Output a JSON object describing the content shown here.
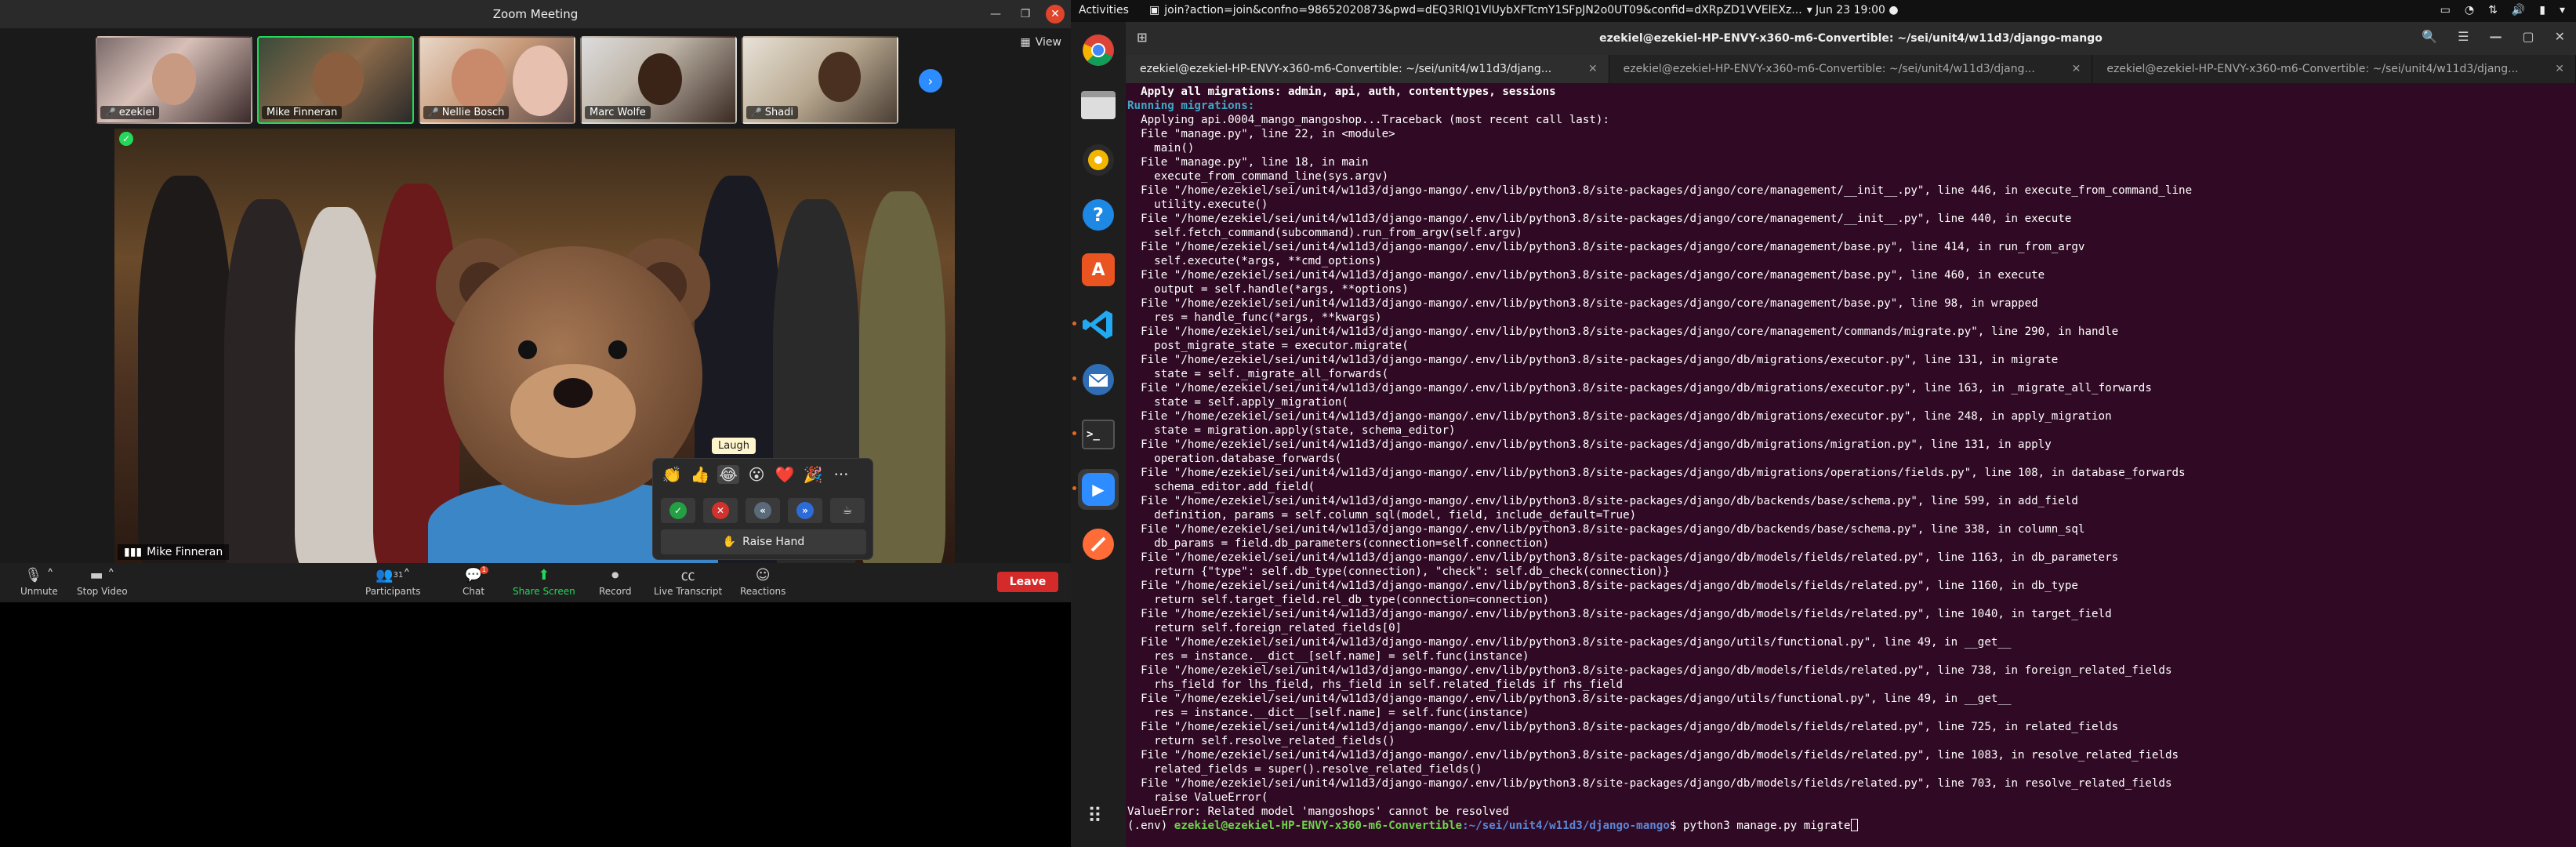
{
  "zoom": {
    "window_title": "Zoom Meeting",
    "view_label": "View",
    "participants_thumbs": [
      {
        "name": "ezekiel",
        "muted": true
      },
      {
        "name": "Mike Finneran",
        "muted": false,
        "active": true
      },
      {
        "name": "Nellie Bosch",
        "muted": true
      },
      {
        "name": "Marc Wolfe",
        "muted": false
      },
      {
        "name": "Shadi",
        "muted": true
      }
    ],
    "main_speaker": "Mike Finneran",
    "reactions": {
      "tooltip": "Laugh",
      "emojis": [
        "👏",
        "👍",
        "😂",
        "😮",
        "❤️",
        "🎉"
      ],
      "more": "···",
      "raise_hand": "Raise Hand"
    },
    "toolbar": {
      "unmute": "Unmute",
      "stop_video": "Stop Video",
      "participants": "Participants",
      "participants_count": "31",
      "chat": "Chat",
      "chat_badge": "1",
      "share_screen": "Share Screen",
      "record": "Record",
      "live_transcript": "Live Transcript",
      "reactions": "Reactions",
      "leave": "Leave"
    },
    "colors": {
      "accent_green": "#23d959",
      "leave_red": "#d52a2a",
      "share_blue": "#2d8cff"
    }
  },
  "topbar": {
    "activities": "Activities",
    "app_tab": "join?action=join&confno=98652020873&pwd=dEQ3RlQ1VlUybXFTcmY1SFpJN2o0UT09&confid=dXRpZD1VVElEXz...",
    "clock": "Jun 23  19:00"
  },
  "dock": {
    "items": [
      "chrome-icon",
      "files-icon",
      "rhythmbox-icon",
      "help-icon",
      "app-center-icon",
      "vscode-icon",
      "mail-icon",
      "terminal-icon",
      "zoom-icon",
      "postman-icon"
    ]
  },
  "terminal": {
    "title": "ezekiel@ezekiel-HP-ENVY-x360-m6-Convertible: ~/sei/unit4/w11d3/django-mango",
    "tabs": [
      "ezekiel@ezekiel-HP-ENVY-x360-m6-Convertible: ~/sei/unit4/w11d3/djang...",
      "ezekiel@ezekiel-HP-ENVY-x360-m6-Convertible: ~/sei/unit4/w11d3/djang...",
      "ezekiel@ezekiel-HP-ENVY-x360-m6-Convertible: ~/sei/unit4/w11d3/djang..."
    ],
    "lines": [
      {
        "t": "  Apply all migrations: admin, api, auth, contenttypes, sessions",
        "c": "bold-head"
      },
      {
        "t": "Running migrations:",
        "c": "mig"
      },
      {
        "t": "  Applying api.0004_mango_mangoshop...Traceback (most recent call last):",
        "c": ""
      },
      {
        "t": "  File \"manage.py\", line 22, in <module>",
        "c": ""
      },
      {
        "t": "    main()",
        "c": ""
      },
      {
        "t": "  File \"manage.py\", line 18, in main",
        "c": ""
      },
      {
        "t": "    execute_from_command_line(sys.argv)",
        "c": ""
      },
      {
        "t": "  File \"/home/ezekiel/sei/unit4/w11d3/django-mango/.env/lib/python3.8/site-packages/django/core/management/__init__.py\", line 446, in execute_from_command_line",
        "c": ""
      },
      {
        "t": "    utility.execute()",
        "c": ""
      },
      {
        "t": "  File \"/home/ezekiel/sei/unit4/w11d3/django-mango/.env/lib/python3.8/site-packages/django/core/management/__init__.py\", line 440, in execute",
        "c": ""
      },
      {
        "t": "    self.fetch_command(subcommand).run_from_argv(self.argv)",
        "c": ""
      },
      {
        "t": "  File \"/home/ezekiel/sei/unit4/w11d3/django-mango/.env/lib/python3.8/site-packages/django/core/management/base.py\", line 414, in run_from_argv",
        "c": ""
      },
      {
        "t": "    self.execute(*args, **cmd_options)",
        "c": ""
      },
      {
        "t": "  File \"/home/ezekiel/sei/unit4/w11d3/django-mango/.env/lib/python3.8/site-packages/django/core/management/base.py\", line 460, in execute",
        "c": ""
      },
      {
        "t": "    output = self.handle(*args, **options)",
        "c": ""
      },
      {
        "t": "  File \"/home/ezekiel/sei/unit4/w11d3/django-mango/.env/lib/python3.8/site-packages/django/core/management/base.py\", line 98, in wrapped",
        "c": ""
      },
      {
        "t": "    res = handle_func(*args, **kwargs)",
        "c": ""
      },
      {
        "t": "  File \"/home/ezekiel/sei/unit4/w11d3/django-mango/.env/lib/python3.8/site-packages/django/core/management/commands/migrate.py\", line 290, in handle",
        "c": ""
      },
      {
        "t": "    post_migrate_state = executor.migrate(",
        "c": ""
      },
      {
        "t": "  File \"/home/ezekiel/sei/unit4/w11d3/django-mango/.env/lib/python3.8/site-packages/django/db/migrations/executor.py\", line 131, in migrate",
        "c": ""
      },
      {
        "t": "    state = self._migrate_all_forwards(",
        "c": ""
      },
      {
        "t": "  File \"/home/ezekiel/sei/unit4/w11d3/django-mango/.env/lib/python3.8/site-packages/django/db/migrations/executor.py\", line 163, in _migrate_all_forwards",
        "c": ""
      },
      {
        "t": "    state = self.apply_migration(",
        "c": ""
      },
      {
        "t": "  File \"/home/ezekiel/sei/unit4/w11d3/django-mango/.env/lib/python3.8/site-packages/django/db/migrations/executor.py\", line 248, in apply_migration",
        "c": ""
      },
      {
        "t": "    state = migration.apply(state, schema_editor)",
        "c": ""
      },
      {
        "t": "  File \"/home/ezekiel/sei/unit4/w11d3/django-mango/.env/lib/python3.8/site-packages/django/db/migrations/migration.py\", line 131, in apply",
        "c": ""
      },
      {
        "t": "    operation.database_forwards(",
        "c": ""
      },
      {
        "t": "  File \"/home/ezekiel/sei/unit4/w11d3/django-mango/.env/lib/python3.8/site-packages/django/db/migrations/operations/fields.py\", line 108, in database_forwards",
        "c": ""
      },
      {
        "t": "    schema_editor.add_field(",
        "c": ""
      },
      {
        "t": "  File \"/home/ezekiel/sei/unit4/w11d3/django-mango/.env/lib/python3.8/site-packages/django/db/backends/base/schema.py\", line 599, in add_field",
        "c": ""
      },
      {
        "t": "    definition, params = self.column_sql(model, field, include_default=True)",
        "c": ""
      },
      {
        "t": "  File \"/home/ezekiel/sei/unit4/w11d3/django-mango/.env/lib/python3.8/site-packages/django/db/backends/base/schema.py\", line 338, in column_sql",
        "c": ""
      },
      {
        "t": "    db_params = field.db_parameters(connection=self.connection)",
        "c": ""
      },
      {
        "t": "  File \"/home/ezekiel/sei/unit4/w11d3/django-mango/.env/lib/python3.8/site-packages/django/db/models/fields/related.py\", line 1163, in db_parameters",
        "c": ""
      },
      {
        "t": "    return {\"type\": self.db_type(connection), \"check\": self.db_check(connection)}",
        "c": ""
      },
      {
        "t": "  File \"/home/ezekiel/sei/unit4/w11d3/django-mango/.env/lib/python3.8/site-packages/django/db/models/fields/related.py\", line 1160, in db_type",
        "c": ""
      },
      {
        "t": "    return self.target_field.rel_db_type(connection=connection)",
        "c": ""
      },
      {
        "t": "  File \"/home/ezekiel/sei/unit4/w11d3/django-mango/.env/lib/python3.8/site-packages/django/db/models/fields/related.py\", line 1040, in target_field",
        "c": ""
      },
      {
        "t": "    return self.foreign_related_fields[0]",
        "c": ""
      },
      {
        "t": "  File \"/home/ezekiel/sei/unit4/w11d3/django-mango/.env/lib/python3.8/site-packages/django/utils/functional.py\", line 49, in __get__",
        "c": ""
      },
      {
        "t": "    res = instance.__dict__[self.name] = self.func(instance)",
        "c": ""
      },
      {
        "t": "  File \"/home/ezekiel/sei/unit4/w11d3/django-mango/.env/lib/python3.8/site-packages/django/db/models/fields/related.py\", line 738, in foreign_related_fields",
        "c": ""
      },
      {
        "t": "    rhs_field for lhs_field, rhs_field in self.related_fields if rhs_field",
        "c": ""
      },
      {
        "t": "  File \"/home/ezekiel/sei/unit4/w11d3/django-mango/.env/lib/python3.8/site-packages/django/utils/functional.py\", line 49, in __get__",
        "c": ""
      },
      {
        "t": "    res = instance.__dict__[self.name] = self.func(instance)",
        "c": ""
      },
      {
        "t": "  File \"/home/ezekiel/sei/unit4/w11d3/django-mango/.env/lib/python3.8/site-packages/django/db/models/fields/related.py\", line 725, in related_fields",
        "c": ""
      },
      {
        "t": "    return self.resolve_related_fields()",
        "c": ""
      },
      {
        "t": "  File \"/home/ezekiel/sei/unit4/w11d3/django-mango/.env/lib/python3.8/site-packages/django/db/models/fields/related.py\", line 1083, in resolve_related_fields",
        "c": ""
      },
      {
        "t": "    related_fields = super().resolve_related_fields()",
        "c": ""
      },
      {
        "t": "  File \"/home/ezekiel/sei/unit4/w11d3/django-mango/.env/lib/python3.8/site-packages/django/db/models/fields/related.py\", line 703, in resolve_related_fields",
        "c": ""
      },
      {
        "t": "    raise ValueError(",
        "c": ""
      },
      {
        "t": "ValueError: Related model 'mangoshops' cannot be resolved",
        "c": ""
      }
    ],
    "prompt": {
      "env": "(.env) ",
      "user": "ezekiel@ezekiel-HP-ENVY-x360-m6-Convertible",
      "path": ":~/sei/unit4/w11d3/django-mango",
      "command": "$ python3 manage.py migrate"
    }
  }
}
